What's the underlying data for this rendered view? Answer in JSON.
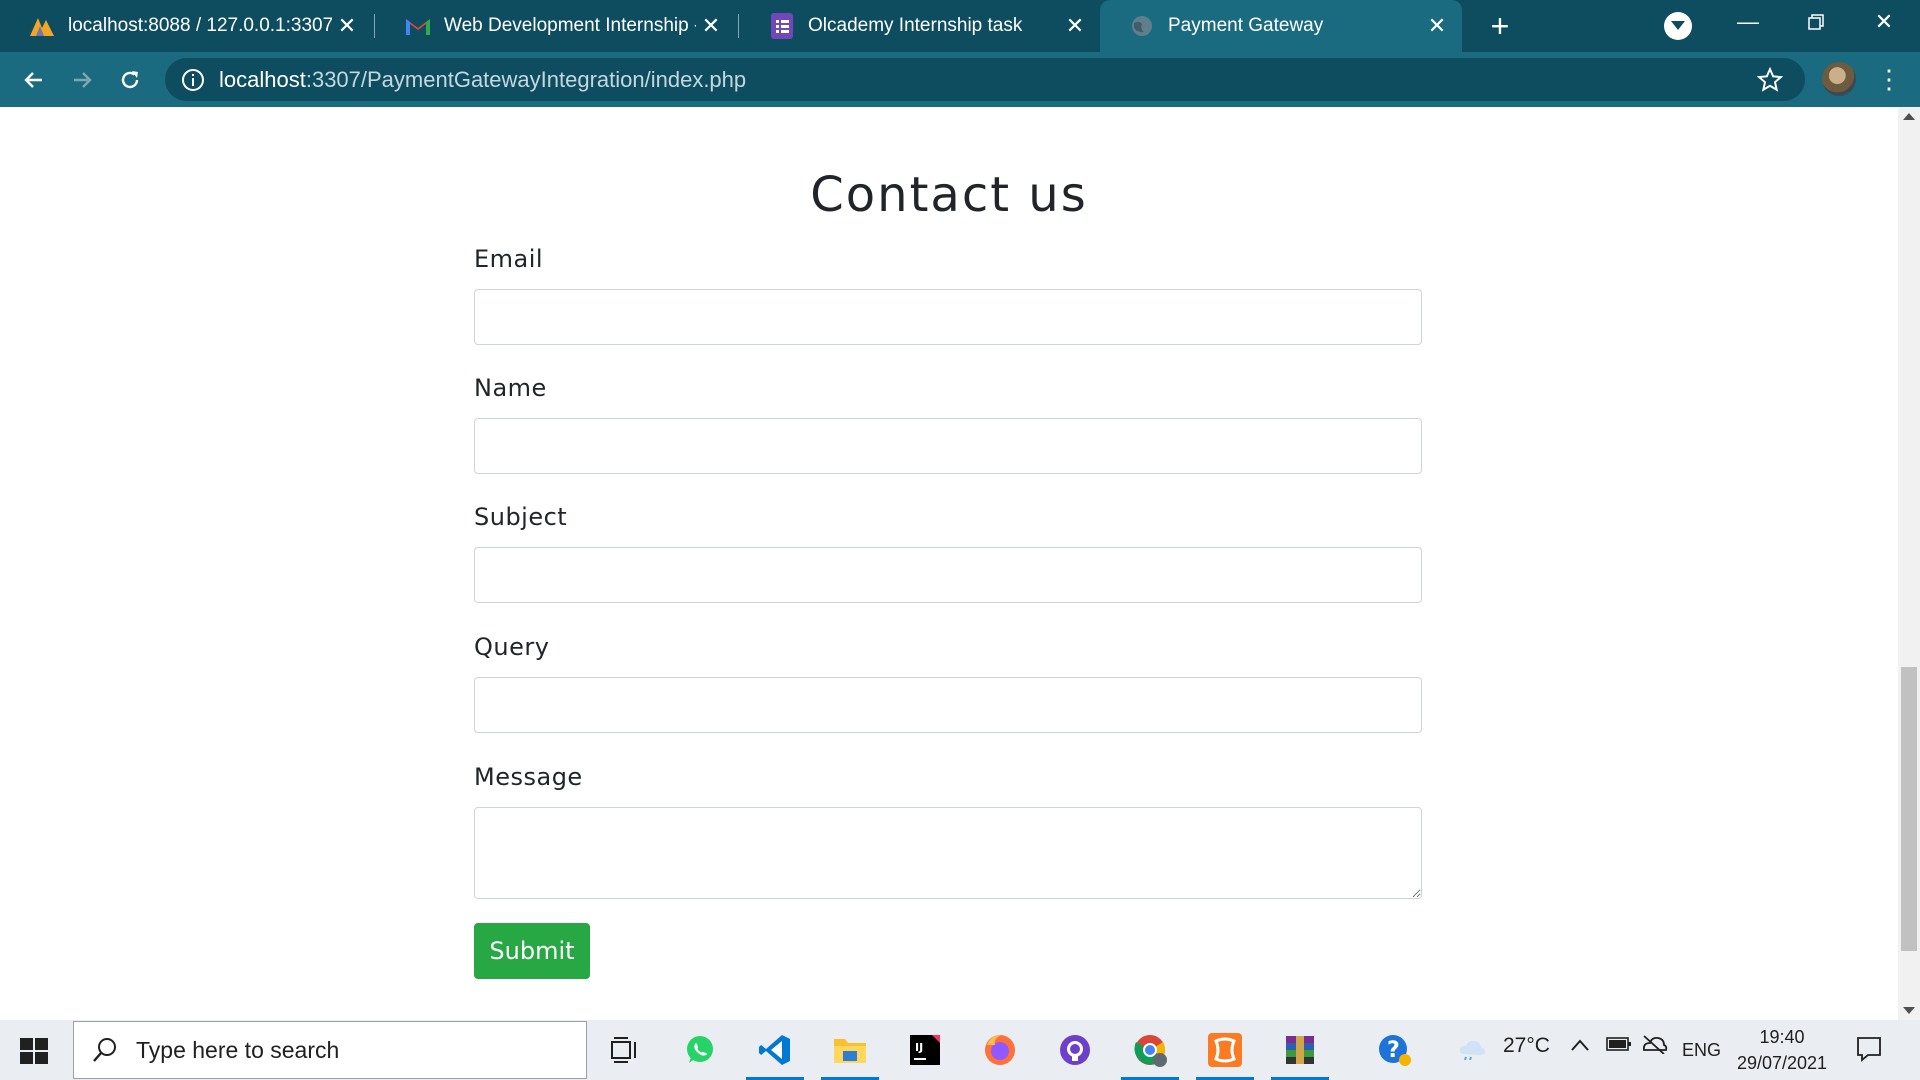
{
  "browser": {
    "tabs": [
      {
        "title": "localhost:8088 / 127.0.0.1:3307 / ",
        "icon": "phpmyadmin-icon"
      },
      {
        "title": "Web Development Internship - ta",
        "icon": "gmail-icon"
      },
      {
        "title": "Olcademy Internship task",
        "icon": "forms-icon"
      },
      {
        "title": "Payment Gateway",
        "icon": "globe-icon"
      }
    ],
    "url_host": "localhost",
    "url_path": ":3307/PaymentGatewayIntegration/index.php"
  },
  "form": {
    "title": "Contact us",
    "fields": [
      {
        "label": "Email",
        "value": ""
      },
      {
        "label": "Name",
        "value": ""
      },
      {
        "label": "Subject",
        "value": ""
      },
      {
        "label": "Query",
        "value": ""
      },
      {
        "label": "Message",
        "value": ""
      }
    ],
    "submit_label": "Submit"
  },
  "taskbar": {
    "search_placeholder": "Type here to search",
    "apps": [
      "task-view-icon",
      "whatsapp-icon",
      "vscode-icon",
      "file-explorer-icon",
      "intellij-icon",
      "firefox-icon",
      "github-desktop-icon",
      "chrome-icon",
      "xampp-icon",
      "winrar-icon",
      "help-icon"
    ],
    "weather": "27°C",
    "language": "ENG",
    "time": "19:40",
    "date": "29/07/2021"
  },
  "colors": {
    "browser_frame": "#0e4d5f",
    "toolbar": "#1a6a80",
    "submit_button": "#28a745"
  }
}
